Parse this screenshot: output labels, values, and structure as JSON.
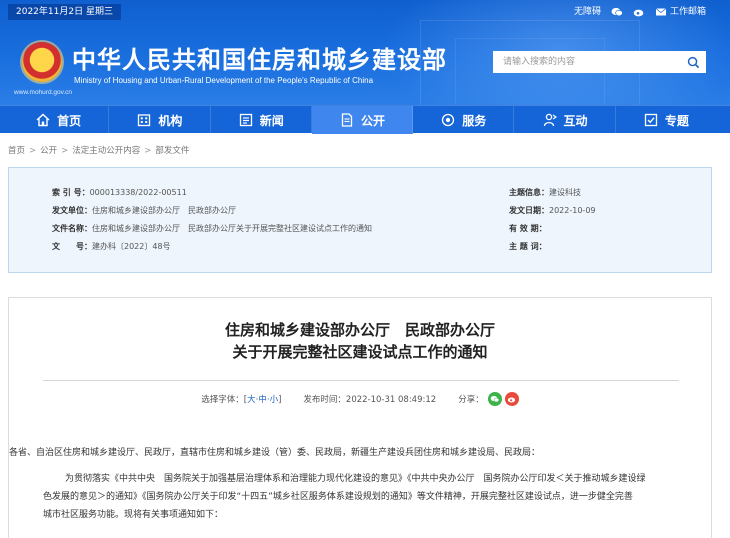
{
  "topbar": {
    "date": "2022年11月2日 星期三",
    "accessibility": "无障碍",
    "email": "工作邮箱"
  },
  "site": {
    "title": "中华人民共和国住房和城乡建设部",
    "subtitle": "Ministry of Housing and Urban-Rural Development of the People's Republic of China",
    "url": "www.mohurd.gov.cn"
  },
  "search": {
    "placeholder": "请输入搜索的内容"
  },
  "nav": {
    "items": [
      {
        "label": "首页",
        "icon": "home-icon"
      },
      {
        "label": "机构",
        "icon": "building-icon"
      },
      {
        "label": "新闻",
        "icon": "news-icon"
      },
      {
        "label": "公开",
        "icon": "document-icon",
        "active": true
      },
      {
        "label": "服务",
        "icon": "service-icon"
      },
      {
        "label": "互动",
        "icon": "interaction-icon"
      },
      {
        "label": "专题",
        "icon": "topic-icon"
      }
    ]
  },
  "breadcrumb": [
    "首页",
    "公开",
    "法定主动公开内容",
    "部发文件"
  ],
  "meta": {
    "index_label": "索 引 号：",
    "index_value": "000013338/2022-00511",
    "unit_label": "发文单位：",
    "unit_value": "住房和城乡建设部办公厅　民政部办公厅",
    "name_label": "文件名称：",
    "name_value": "住房和城乡建设部办公厅　民政部办公厅关于开展完整社区建设试点工作的通知",
    "doc_label": "文　　号：",
    "doc_value": "建办科〔2022〕48号",
    "topic_label": "主题信息：",
    "topic_value": "建设科技",
    "date_label": "发文日期：",
    "date_value": "2022-10-09",
    "valid_label": "有 效 期：",
    "valid_value": "",
    "keywords_label": "主 题 词：",
    "keywords_value": ""
  },
  "article": {
    "title_line1": "住房和城乡建设部办公厅　民政部办公厅",
    "title_line2": "关于开展完整社区建设试点工作的通知",
    "font_label": "选择字体：[",
    "font_large": "大",
    "font_medium": "中",
    "font_small": "小",
    "font_close": "]",
    "publish_time": "发布时间：2022-10-31 08:49:12",
    "share_label": "分享：",
    "recipients": "各省、自治区住房和城乡建设厅、民政厅，直辖市住房和城乡建设（管）委、民政局，新疆生产建设兵团住房和城乡建设局、民政局：",
    "para1_line1": "为贯彻落实《中共中央　国务院关于加强基层治理体系和治理能力现代化建设的意见》《中共中央办公厅　国务院办公厅印发＜关于推动城乡建设绿",
    "para1_line2": "色发展的意见＞的通知》《国务院办公厅关于印发“十四五”城乡社区服务体系建设规划的通知》等文件精神，开展完整社区建设试点，进一步健全完善",
    "para1_line3": "城市社区服务功能。现将有关事项通知如下："
  }
}
